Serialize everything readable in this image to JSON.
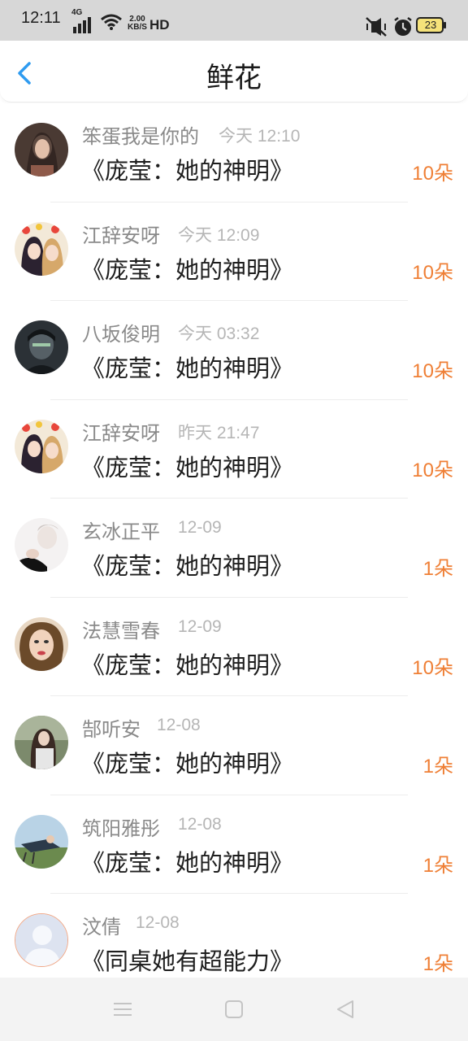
{
  "status_bar": {
    "time": "12:11",
    "network": "4G",
    "speed_value": "2.00",
    "speed_unit": "KB/S",
    "hd": "HD",
    "battery": "23",
    "icons": [
      "signal-icon",
      "wifi-icon",
      "mute-vibrate-icon",
      "alarm-icon",
      "battery-icon"
    ]
  },
  "header": {
    "title": "鲜花",
    "back_icon": "chevron-left-icon",
    "accent_color": "#2e9bf0"
  },
  "colors": {
    "count": "#ef7f35",
    "name": "#8a8a8a",
    "time": "#b6b6b6"
  },
  "items": [
    {
      "name": "笨蛋我是你的",
      "time": "今天 12:10",
      "book": "《庞莹：她的神明》",
      "count": "10朵"
    },
    {
      "name": "江辞安呀",
      "time": "今天 12:09",
      "book": "《庞莹：她的神明》",
      "count": "10朵"
    },
    {
      "name": "八坂俊明",
      "time": "今天 03:32",
      "book": "《庞莹：她的神明》",
      "count": "10朵"
    },
    {
      "name": "江辞安呀",
      "time": "昨天 21:47",
      "book": "《庞莹：她的神明》",
      "count": "10朵"
    },
    {
      "name": "玄冰正平",
      "time": "12-09",
      "book": "《庞莹：她的神明》",
      "count": "1朵"
    },
    {
      "name": "法慧雪春",
      "time": "12-09",
      "book": "《庞莹：她的神明》",
      "count": "10朵"
    },
    {
      "name": "郜听安",
      "time": "12-08",
      "book": "《庞莹：她的神明》",
      "count": "1朵"
    },
    {
      "name": "筑阳雅彤",
      "time": "12-08",
      "book": "《庞莹：她的神明》",
      "count": "1朵"
    },
    {
      "name": "汶倩",
      "time": "12-08",
      "book": "《同桌她有超能力》",
      "count": "1朵"
    }
  ],
  "nav": {
    "icons": [
      "menu-icon",
      "home-square-icon",
      "back-triangle-icon"
    ]
  }
}
